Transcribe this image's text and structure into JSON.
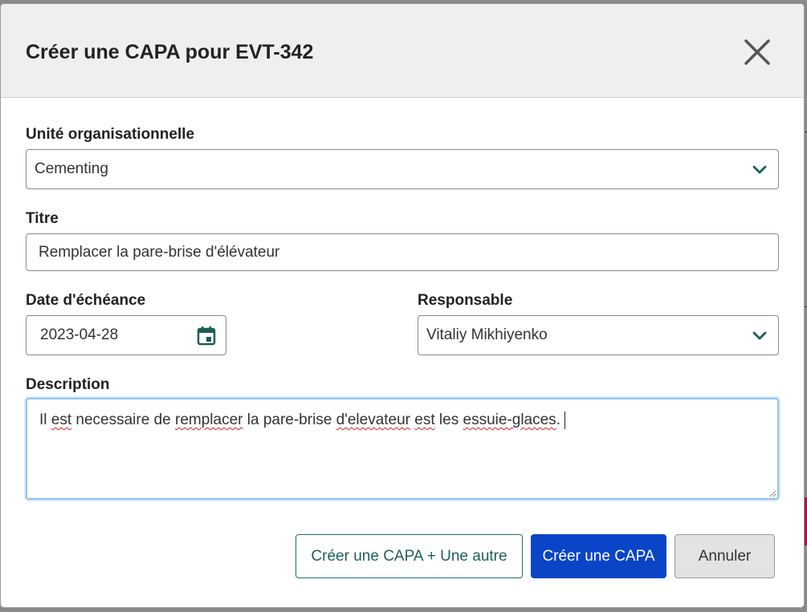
{
  "modal": {
    "title": "Créer une CAPA pour EVT-342",
    "close_label": "×"
  },
  "form": {
    "org_unit": {
      "label": "Unité organisationnelle",
      "value": "Cementing"
    },
    "title": {
      "label": "Titre",
      "value": "Remplacer la pare-brise d'élévateur"
    },
    "due_date": {
      "label": "Date d'échéance",
      "value": "2023-04-28"
    },
    "owner": {
      "label": "Responsable",
      "value": "Vitaliy Mikhiyenko"
    },
    "description": {
      "label": "Description",
      "words": [
        "Il ",
        "est",
        " necessaire de ",
        "remplacer",
        " la pare-brise ",
        "d'elevateur",
        " ",
        "est",
        " les ",
        "essuie-glaces",
        "."
      ]
    }
  },
  "footer": {
    "create_another_label": "Créer une CAPA + Une autre",
    "create_label": "Créer une CAPA",
    "cancel_label": "Annuler"
  },
  "colors": {
    "primary": "#0a45c7",
    "accent_teal": "#1f6f6a",
    "header_bg": "#efefef"
  },
  "icons": {
    "close": "close-icon",
    "chevron": "chevron-down-icon",
    "calendar": "calendar-icon"
  }
}
